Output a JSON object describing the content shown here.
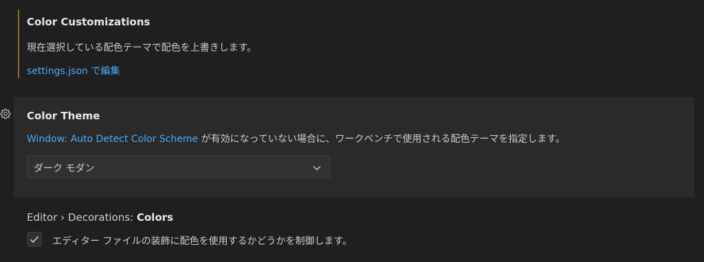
{
  "color_customizations": {
    "title": "Color Customizations",
    "description": "現在選択している配色テーマで配色を上書きします。",
    "edit_link": "settings.json で編集"
  },
  "color_theme": {
    "title": "Color Theme",
    "description_link": "Window: Auto Detect Color Scheme",
    "description_text": " が有効になっていない場合に、ワークベンチで使用される配色テーマを指定します。",
    "selected_value": "ダーク モダン",
    "gear_icon": "gear-icon",
    "chevron_icon": "chevron-down-icon"
  },
  "decorations_colors": {
    "category": "Editor › Decorations: ",
    "name": "Colors",
    "checkbox_label": "エディター ファイルの装飾に配色を使用するかどうかを制御します。",
    "checked": true
  },
  "colors": {
    "background": "#1f1f1f",
    "focused_row": "#2a2a2a",
    "modified_indicator": "#8a6a2a",
    "link": "#4daafc",
    "text": "#cccccc",
    "title": "#e7e7e7"
  }
}
